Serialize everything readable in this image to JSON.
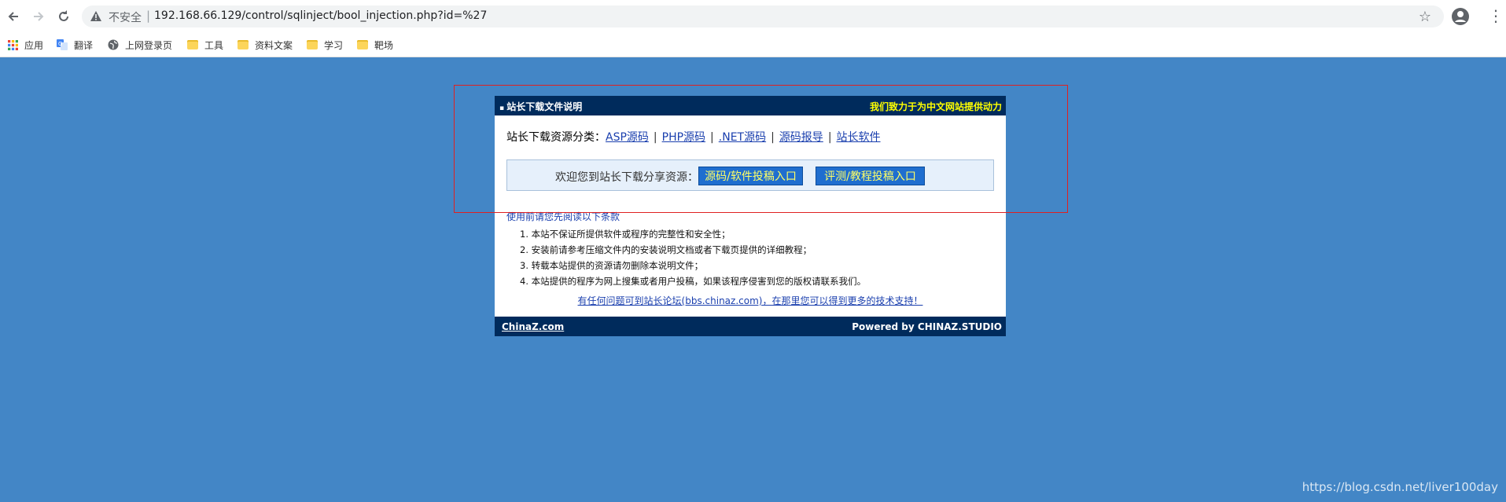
{
  "browser": {
    "security_label": "不安全",
    "url": "192.168.66.129/control/sqlinject/bool_injection.php?id=%27",
    "bookmarks": [
      {
        "label": "应用",
        "icon": "apps-grid-icon"
      },
      {
        "label": "翻译",
        "icon": "translate-icon"
      },
      {
        "label": "上网登录页",
        "icon": "globe-icon"
      },
      {
        "label": "工具",
        "icon": "folder-icon"
      },
      {
        "label": "资料文案",
        "icon": "folder-icon"
      },
      {
        "label": "学习",
        "icon": "folder-icon"
      },
      {
        "label": "靶场",
        "icon": "folder-icon"
      }
    ]
  },
  "panel": {
    "title": "站长下载文件说明",
    "slogan": "我们致力于为中文网站提供动力",
    "category_label": "站长下载资源分类：",
    "categories": [
      "ASP源码",
      "PHP源码",
      ".NET源码",
      "源码报导",
      "站长软件"
    ],
    "welcome_text": "欢迎您到站长下载分享资源：",
    "submit_source_button": "源码/软件投稿入口",
    "submit_review_button": "评测/教程投稿入口",
    "terms_title": "使用前请您先阅读以下条款",
    "terms": [
      "1. 本站不保证所提供软件或程序的完整性和安全性；",
      "2. 安装前请参考压缩文件内的安装说明文档或者下载页提供的详细教程；",
      "3. 转载本站提供的资源请勿删除本说明文件；",
      "4. 本站提供的程序为网上搜集或者用户投稿，如果该程序侵害到您的版权请联系我们。"
    ],
    "forum_link": "有任何问题可到站长论坛(bbs.chinaz.com)，在那里您可以得到更多的技术支持！",
    "footer_left": "ChinaZ.com",
    "footer_right": "Powered by CHINAZ.STUDIO"
  },
  "watermark": "https://blog.csdn.net/liver100day",
  "colors": {
    "page_background": "#4386c6",
    "panel_header": "#002b5c",
    "slogan_text": "#ffff00",
    "annotation_border": "#e02020"
  }
}
